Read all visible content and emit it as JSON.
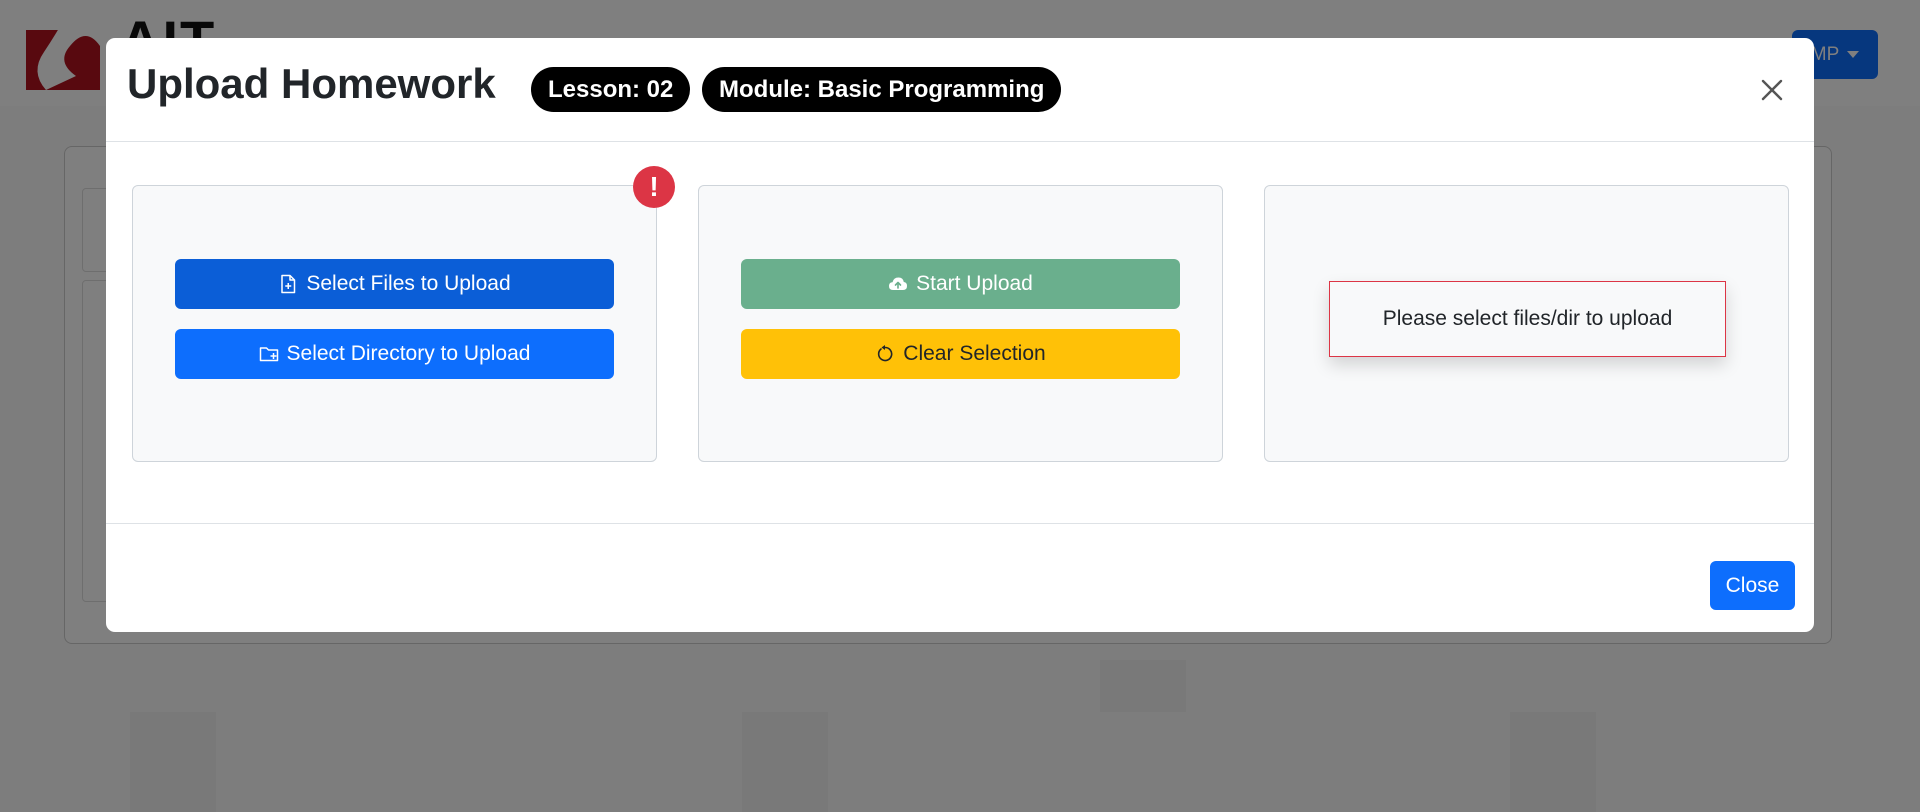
{
  "background": {
    "logo_text": "AIT",
    "user_menu_label": "MP"
  },
  "modal": {
    "title": "Upload Homework",
    "badges": {
      "lesson": "Lesson: 02",
      "module": "Module: Basic Programming"
    },
    "close_icon": "close-icon",
    "alert_icon": "exclamation-icon",
    "alert_symbol": "!",
    "buttons": {
      "select_files": {
        "label": "Select Files to Upload",
        "icon": "file-plus-icon"
      },
      "select_directory": {
        "label": "Select Directory to Upload",
        "icon": "folder-plus-icon"
      },
      "start_upload": {
        "label": "Start Upload",
        "icon": "cloud-upload-icon"
      },
      "clear_selection": {
        "label": "Clear Selection",
        "icon": "refresh-icon"
      }
    },
    "status_message": "Please select files/dir to upload",
    "footer_close_label": "Close"
  },
  "colors": {
    "primary": "#0d6efd",
    "primary_dark": "#0b5ed7",
    "success_disabled": "#6aaf8d",
    "warning": "#ffc107",
    "danger": "#dc3545",
    "badge": "#000000"
  }
}
